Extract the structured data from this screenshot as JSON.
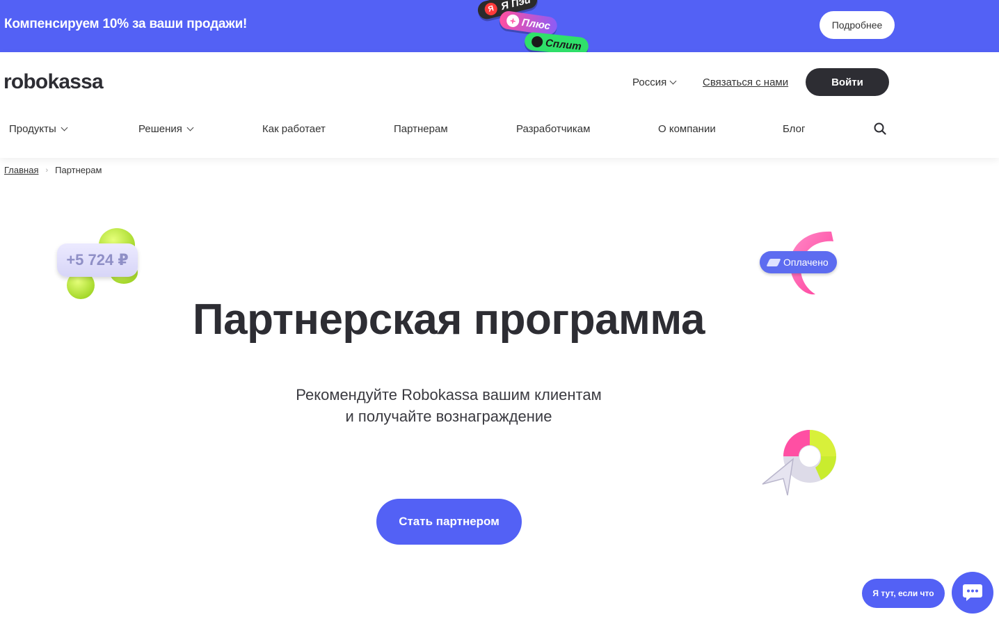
{
  "banner": {
    "text": "Компенсируем 10% за ваши продажи!",
    "pills": [
      "Я Пэй",
      "Плюс",
      "Сплит"
    ],
    "ya_mark": "Я",
    "plus_mark": "+",
    "button": "Подробнее",
    "color": "#5361f5"
  },
  "header": {
    "logo": "robokassa",
    "country": "Россия",
    "contact": "Связаться с нами",
    "login": "Войти"
  },
  "nav": {
    "items": [
      {
        "label": "Продукты",
        "dropdown": true
      },
      {
        "label": "Решения",
        "dropdown": true
      },
      {
        "label": "Как работает",
        "dropdown": false
      },
      {
        "label": "Партнерам",
        "dropdown": false
      },
      {
        "label": "Разработчикам",
        "dropdown": false
      },
      {
        "label": "О компании",
        "dropdown": false
      },
      {
        "label": "Блог",
        "dropdown": false
      }
    ],
    "search_icon": "search-icon"
  },
  "breadcrumb": {
    "home": "Главная",
    "current": "Партнерам"
  },
  "hero": {
    "title": "Партнерская программа",
    "subtitle_line1": "Рекомендуйте Robokassa вашим клиентам",
    "subtitle_line2": "и получайте вознаграждение",
    "cta": "Стать партнером"
  },
  "decor": {
    "money_chip": "+5 724 ₽",
    "paid_pill": "Оплачено"
  },
  "chat": {
    "label": "Я тут, если что",
    "icon": "chat-icon"
  },
  "colors": {
    "accent": "#5361f5",
    "dark": "#2d2d33"
  }
}
